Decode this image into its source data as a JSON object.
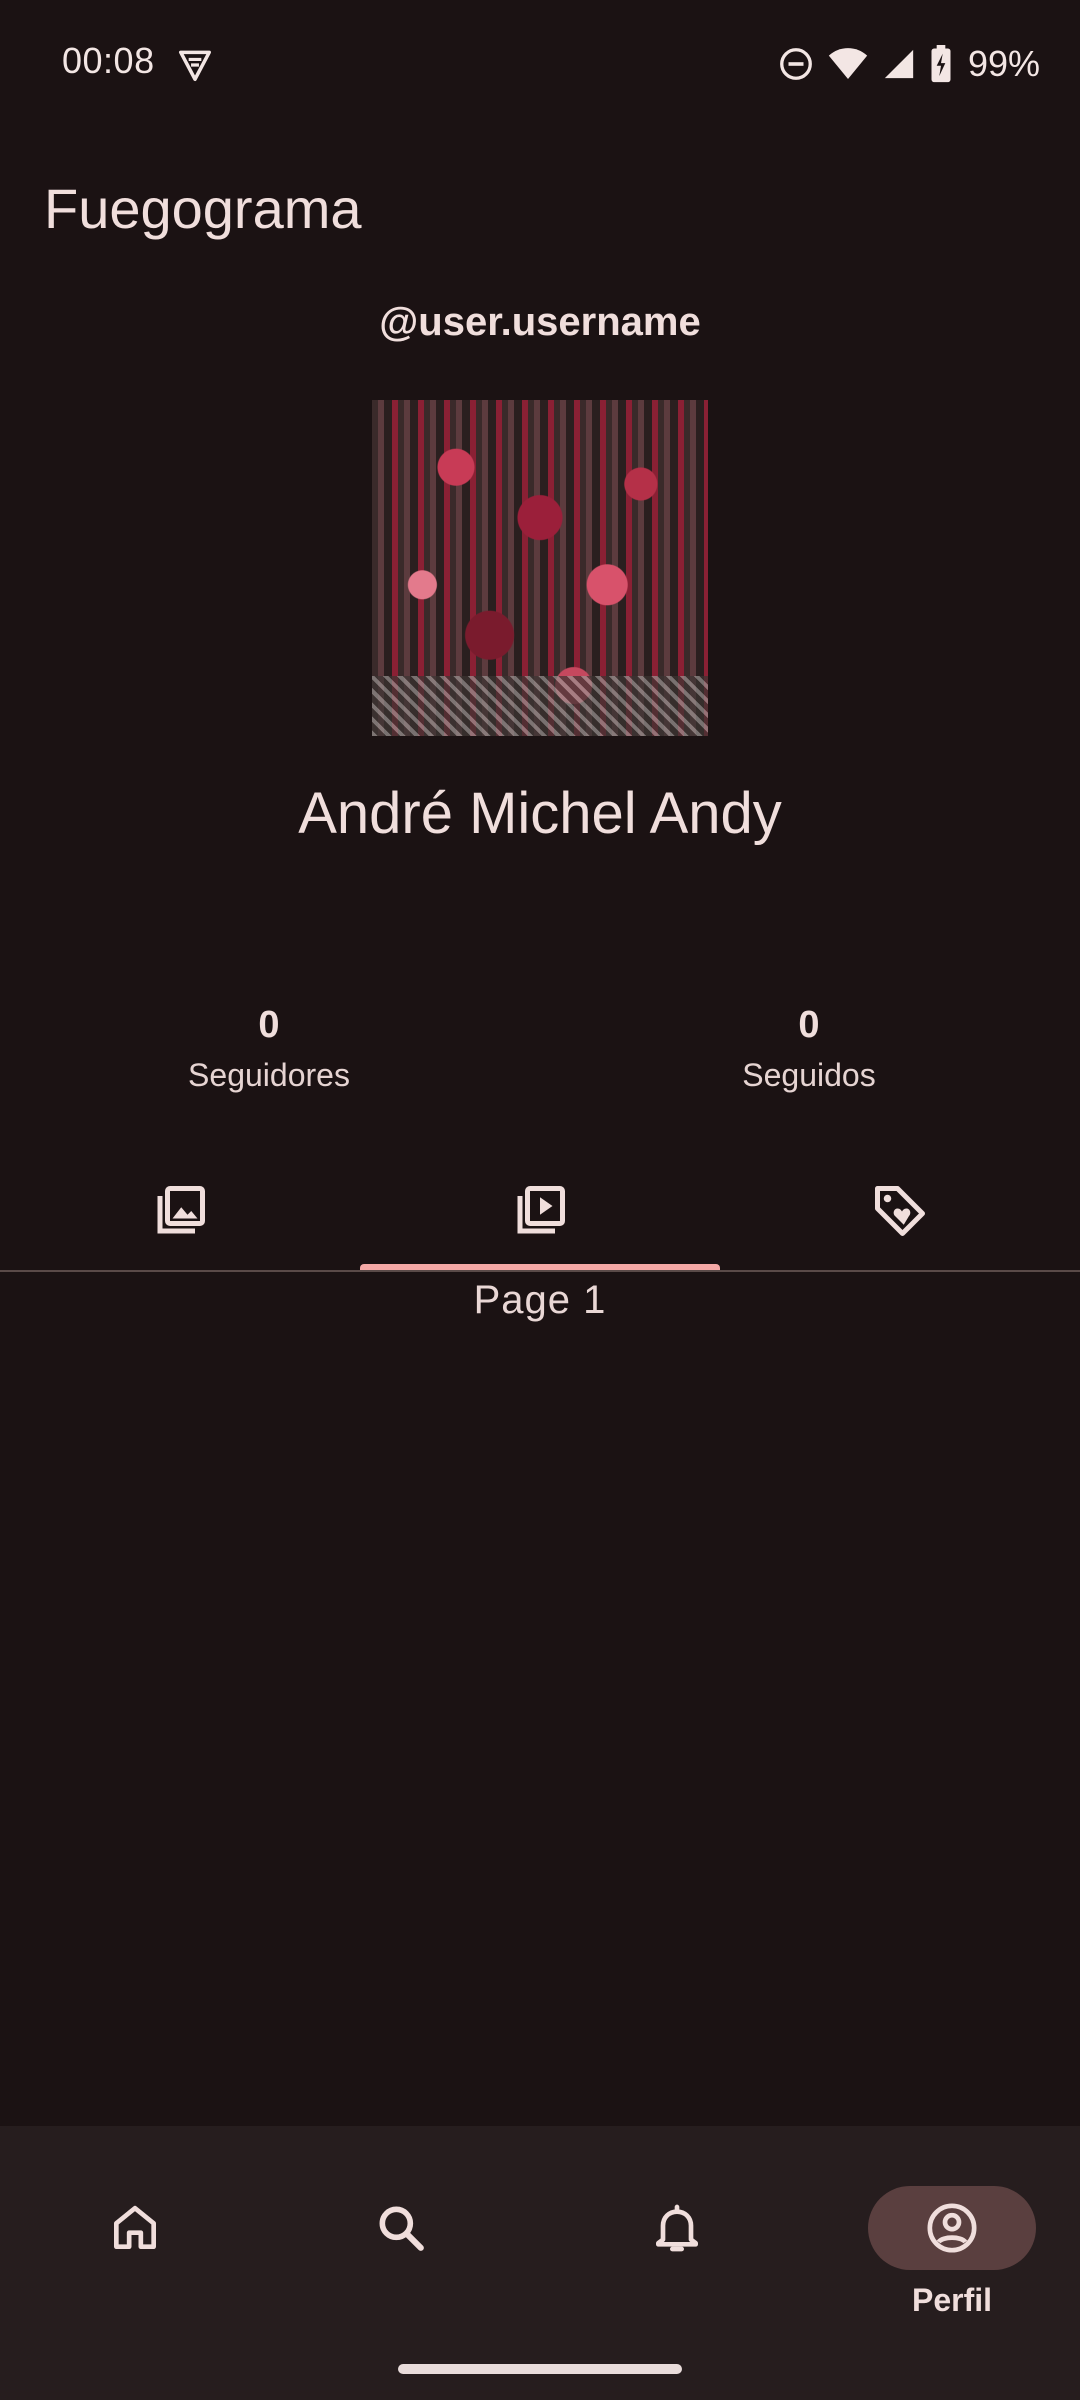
{
  "status_bar": {
    "time": "00:08",
    "battery": "99%",
    "icons": [
      "vpn-icon",
      "do-not-disturb-icon",
      "wifi-icon",
      "cell-signal-icon",
      "battery-charging-icon"
    ]
  },
  "app": {
    "title": "Fuegograma"
  },
  "profile": {
    "username": "@user.username",
    "display_name": "André Michel Andy",
    "stats": [
      {
        "count": "0",
        "label": "Seguidores"
      },
      {
        "count": "0",
        "label": "Seguidos"
      }
    ]
  },
  "tabs": {
    "items": [
      "photos-icon",
      "videos-icon",
      "tagged-icon"
    ],
    "selected_index": 1,
    "page_label": "Page 1"
  },
  "bottom_nav": {
    "items": [
      {
        "icon": "home-icon",
        "label": ""
      },
      {
        "icon": "search-icon",
        "label": ""
      },
      {
        "icon": "notifications-icon",
        "label": ""
      },
      {
        "icon": "profile-icon",
        "label": "Perfil"
      }
    ],
    "active_index": 3
  },
  "colors": {
    "background": "#1b1213",
    "accent": "#f4a8a6",
    "nav_background": "#261d1e",
    "active_pill": "#5a3f3f"
  }
}
